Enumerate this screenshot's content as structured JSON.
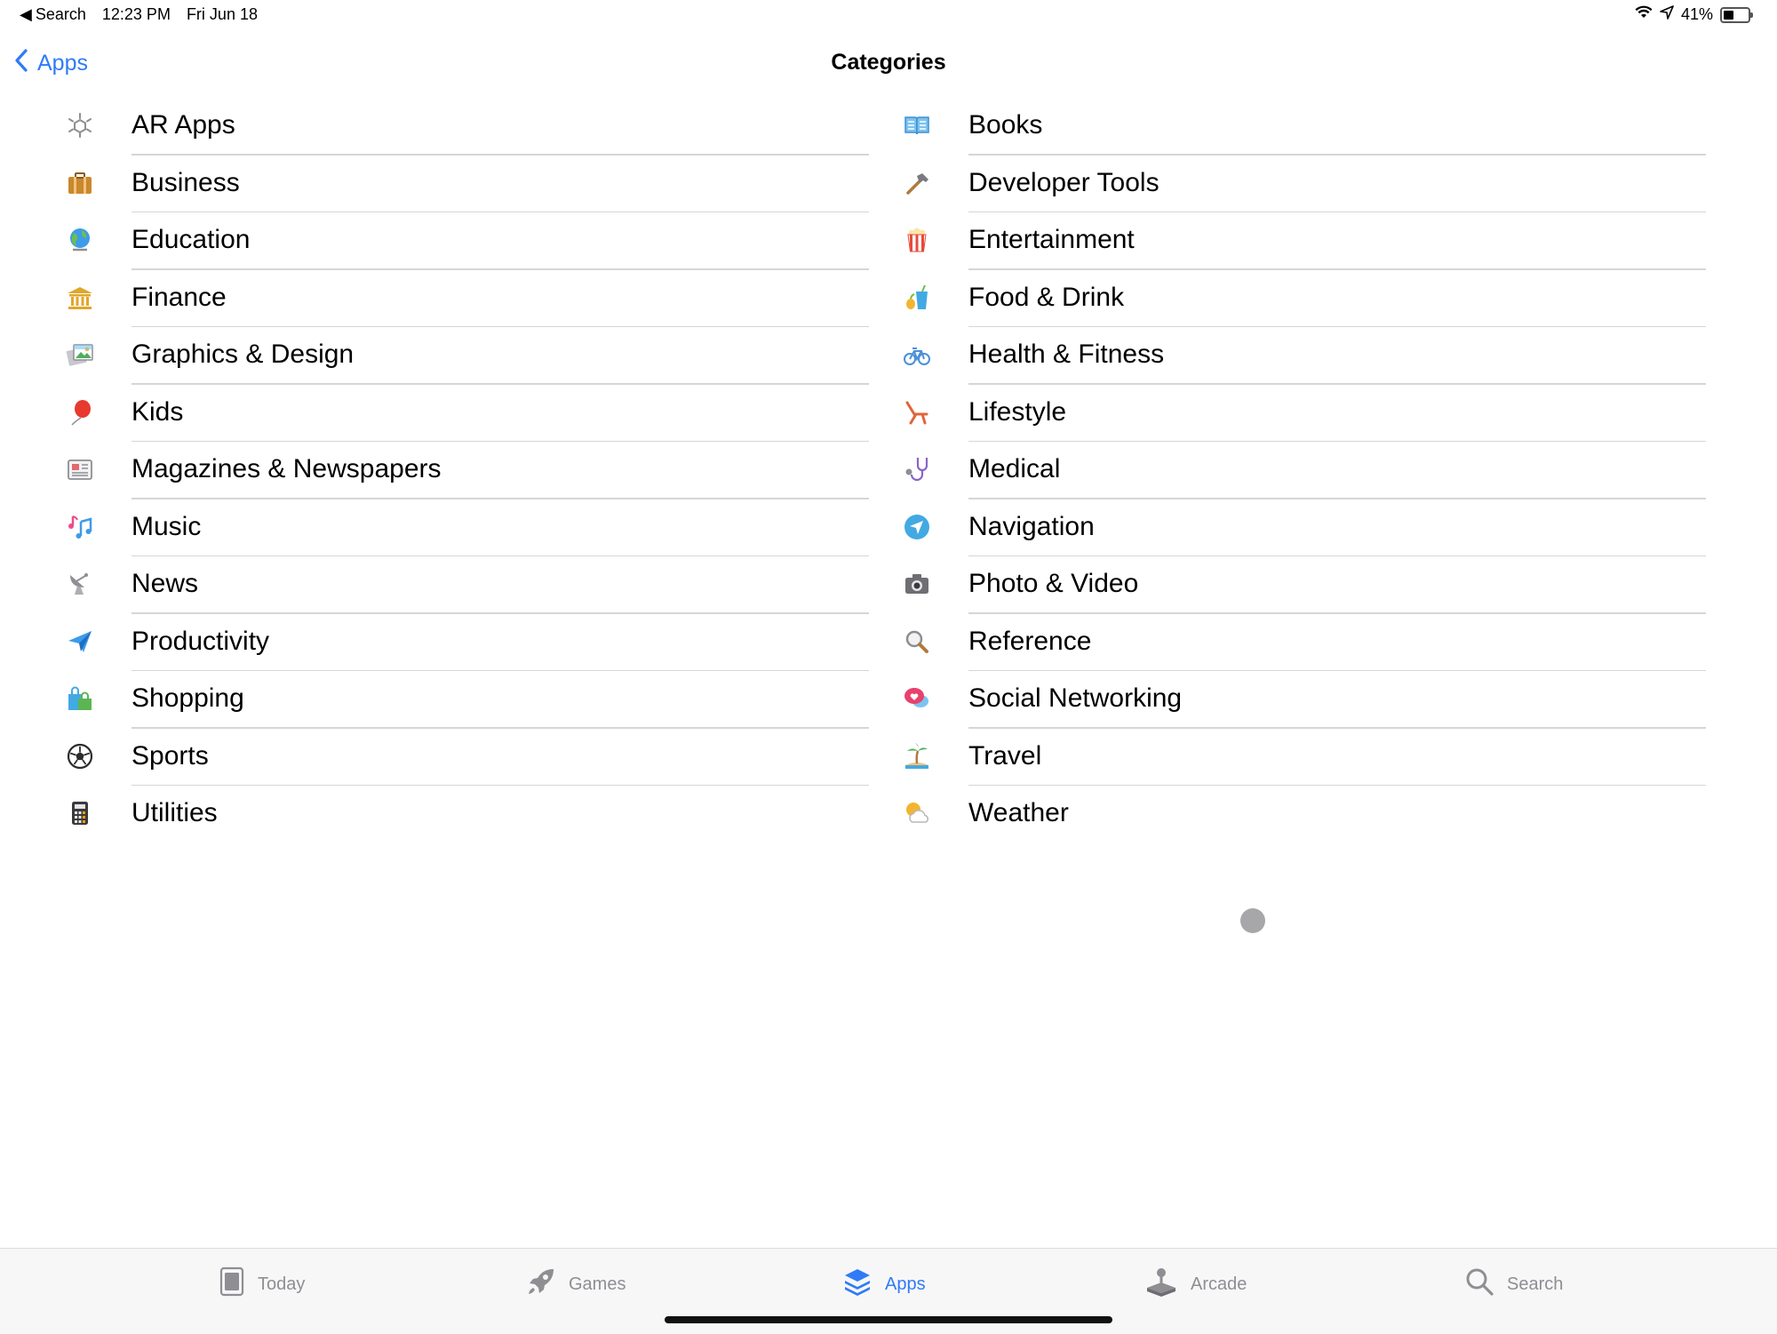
{
  "status_bar": {
    "back_app": "Search",
    "time": "12:23 PM",
    "date": "Fri Jun 18",
    "battery_text": "41%",
    "battery_level": 0.41
  },
  "nav": {
    "back_label": "Apps",
    "title": "Categories"
  },
  "categories_left": [
    {
      "label": "AR Apps",
      "icon": "ar-cube-icon"
    },
    {
      "label": "Business",
      "icon": "briefcase-icon"
    },
    {
      "label": "Education",
      "icon": "globe-icon"
    },
    {
      "label": "Finance",
      "icon": "bank-icon"
    },
    {
      "label": "Graphics & Design",
      "icon": "picture-icon"
    },
    {
      "label": "Kids",
      "icon": "balloon-icon"
    },
    {
      "label": "Magazines & Newspapers",
      "icon": "newspaper-icon"
    },
    {
      "label": "Music",
      "icon": "music-notes-icon"
    },
    {
      "label": "News",
      "icon": "satellite-dish-icon"
    },
    {
      "label": "Productivity",
      "icon": "paper-plane-icon"
    },
    {
      "label": "Shopping",
      "icon": "shopping-bags-icon"
    },
    {
      "label": "Sports",
      "icon": "soccer-ball-icon"
    },
    {
      "label": "Utilities",
      "icon": "calculator-icon"
    }
  ],
  "categories_right": [
    {
      "label": "Books",
      "icon": "open-book-icon"
    },
    {
      "label": "Developer Tools",
      "icon": "hammer-icon"
    },
    {
      "label": "Entertainment",
      "icon": "popcorn-icon"
    },
    {
      "label": "Food & Drink",
      "icon": "drink-icon"
    },
    {
      "label": "Health & Fitness",
      "icon": "bicycle-icon"
    },
    {
      "label": "Lifestyle",
      "icon": "lounge-chair-icon"
    },
    {
      "label": "Medical",
      "icon": "stethoscope-icon"
    },
    {
      "label": "Navigation",
      "icon": "location-arrow-icon"
    },
    {
      "label": "Photo & Video",
      "icon": "camera-icon"
    },
    {
      "label": "Reference",
      "icon": "magnifier-icon"
    },
    {
      "label": "Social Networking",
      "icon": "chat-heart-icon"
    },
    {
      "label": "Travel",
      "icon": "palm-island-icon"
    },
    {
      "label": "Weather",
      "icon": "sun-cloud-icon"
    }
  ],
  "tabs": [
    {
      "label": "Today",
      "icon": "today-icon",
      "active": false
    },
    {
      "label": "Games",
      "icon": "rocket-icon",
      "active": false
    },
    {
      "label": "Apps",
      "icon": "layers-icon",
      "active": true
    },
    {
      "label": "Arcade",
      "icon": "joystick-icon",
      "active": false
    },
    {
      "label": "Search",
      "icon": "search-icon",
      "active": false
    }
  ],
  "colors": {
    "accent": "#2f7bf6",
    "inactive_tab": "#8e8e93",
    "divider": "#d6d6d8"
  }
}
